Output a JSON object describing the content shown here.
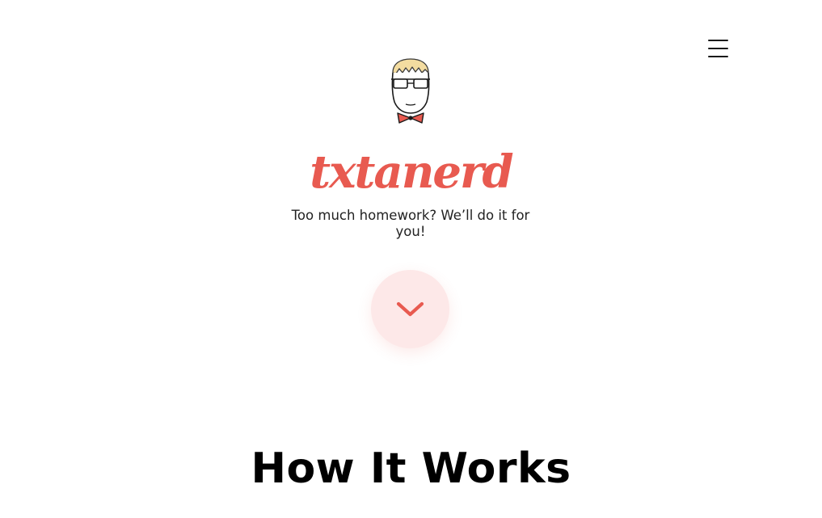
{
  "header": {
    "menu_icon": "hamburger-menu-icon"
  },
  "hero": {
    "logo_icon": "nerd-mascot-logo-icon",
    "brand_name": "txtanerd",
    "tagline": "Too much homework? We’ll do it for you!",
    "scroll_icon": "chevron-down-icon"
  },
  "section": {
    "title": "How It Works"
  },
  "colors": {
    "accent": "#e85a50",
    "accent_soft": "#fde8e8",
    "text": "#222222",
    "heading": "#000000"
  }
}
